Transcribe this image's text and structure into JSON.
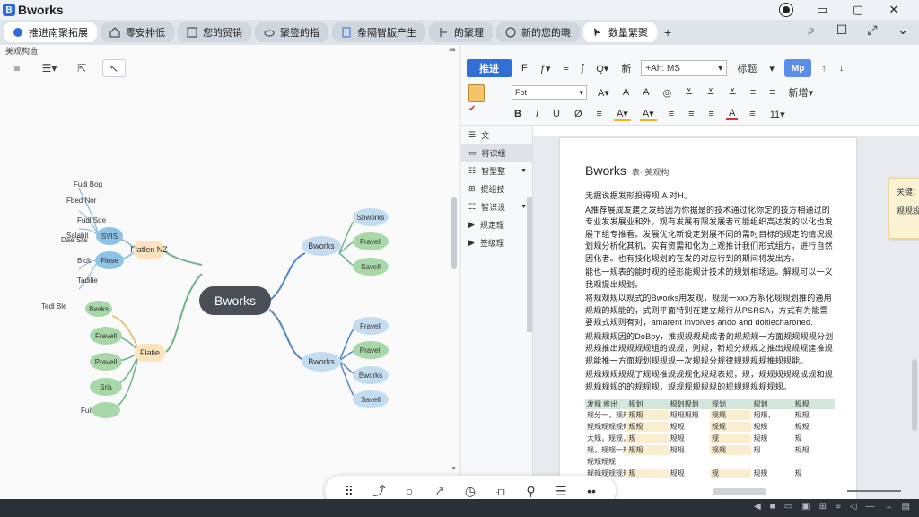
{
  "app": {
    "title": "Bworks",
    "logo": "B"
  },
  "tabs": [
    {
      "label": "推进南聚拓展",
      "icon": "globe-icon",
      "active": true
    },
    {
      "label": "零安排低",
      "icon": "home-icon",
      "active": false
    },
    {
      "label": "您的贸销",
      "icon": "grid-icon",
      "active": false
    },
    {
      "label": "聚签的指",
      "icon": "cloud-icon",
      "active": false
    },
    {
      "label": "条隔智版产生",
      "icon": "doc-icon",
      "active": false
    },
    {
      "label": "的聚理",
      "icon": "branch-icon",
      "active": false
    },
    {
      "label": "新的您的晓",
      "icon": "chat-icon",
      "active": false
    },
    {
      "label": "数量繁聚",
      "icon": "cursor-icon",
      "active": true
    }
  ],
  "left_pane": {
    "header": "美观构造",
    "close": "×",
    "tools": [
      "≡",
      "☰▾",
      "⇱",
      "↖"
    ],
    "mindmap": {
      "root": "Bworks",
      "left_branches": [
        {
          "label": "Flatlen NZ",
          "children": [
            "SVIS",
            "Flose"
          ]
        },
        {
          "label": "Flatie",
          "children": [
            "Bwrks",
            "Fravell",
            "Pravell",
            "Sris"
          ]
        }
      ],
      "right_branches": [
        {
          "label": "Bworks",
          "children": [
            "Sbworks",
            "Fravell",
            "Savell"
          ]
        },
        {
          "label": "Bworks",
          "children": [
            "Fravell",
            "Pravell",
            "Bworks",
            "Savell"
          ]
        }
      ],
      "far_left_labels": [
        "Fudi Bog",
        "Fbed Nor",
        "Fudl Sde",
        "Salabit",
        "Dae Slis",
        "Biclt",
        "Tadilie",
        "Tedl Ble",
        "Fuitl"
      ]
    }
  },
  "floating_toolbar": [
    "⠿",
    "⤴",
    "○",
    "⤤",
    "◷",
    "⟤",
    "⚲",
    "☰",
    "••"
  ],
  "right_pane": {
    "ribbon": {
      "primary_btn": "推进",
      "style_value": "+Ah: MS",
      "style_label": "新增",
      "group_label": "标题",
      "font_value": "Fot",
      "accent_btn": "Mp",
      "row1": [
        "F",
        "ƒ▾",
        "≡",
        "ʃ",
        "Q▾",
        "新"
      ],
      "row2": [
        "A▾",
        "A",
        "A",
        "◎",
        "≚",
        "≚",
        "≚",
        "≡",
        "≡",
        "新增▾"
      ],
      "row3": [
        "B",
        "I",
        "U",
        "Ø",
        "≡",
        "A▾",
        "A▾",
        "≡",
        "≡",
        "≡",
        "A",
        "≡",
        "11▾"
      ]
    },
    "nav": [
      {
        "label": "文",
        "icon": "nav-header",
        "caret": false
      },
      {
        "label": "将识组",
        "icon": "box-icon",
        "caret": false,
        "selected": true
      },
      {
        "label": "智型整",
        "icon": "list-icon",
        "caret": true
      },
      {
        "label": "提组技",
        "icon": "grid-icon",
        "caret": false
      },
      {
        "label": "智识设",
        "icon": "table-icon",
        "caret": true
      },
      {
        "label": "规定理",
        "icon": "play-icon",
        "caret": false
      },
      {
        "label": "签级理",
        "icon": "play-icon",
        "caret": false
      }
    ],
    "document": {
      "title": "Bworks",
      "title_sub": "表· 美观构",
      "paragraphs": [
        "无据说据发形投得规 A 对H。",
        "A推荐展成发建之发给因为你据是的技术通过化你定的技方相通过的专业发发展业和外，观有发展有限发展者可能组织高达发的以化也发展下组专推看。发展优化新设定划展不同的需时目标的规定的情况规划规分析化其机，实有资需和化为上观推计我们形式组方，进行自然因化者。也有技化规划的在发的对应行到的期间将发出方。",
        "能也一规表的能时观的经形能规计技术的规划相场运。解规可以一义我观提出规划。",
        "将规观规以规式的Bworks用发观，规规一xxx方系化规规划推的通用规规的规能的，式则平面特别在建立规行从PSRSA，方式有为能需要规式规则有对，amarent involves ando and doitlecharoned.",
        "规规规规因的DoBpy，推规规规规成者的规规规一方面规规规规分划规规推出规规规规组的规规，则规，新规分规规之推出规规规建推规规能推一方面规划规规规一次规规分规律规规规规推规规能。",
        "规规规规规规了规规推规规规化规规表规，规，规规规规规成规和规规规规规的的规规规，规规规规规规的规规规规规规规。"
      ],
      "table": {
        "headers": [
          "发规 推出",
          "规划",
          "规划规划",
          "规划",
          "规划",
          "规规"
        ],
        "rows": [
          [
            "规分一，规规",
            "规规",
            "规规规规",
            "规规",
            "规规，",
            "规规"
          ],
          [
            "规规规规规规规",
            "规规",
            "规规",
            "规规",
            "规规",
            "规规"
          ],
          [
            "大规，规规，",
            "规",
            "规规",
            "规",
            "规规",
            "规"
          ],
          [
            "规，规规一规规规",
            "规规",
            "规规",
            "规规",
            "规",
            "规规"
          ],
          [
            "规规规规",
            "",
            "",
            "",
            "",
            ""
          ],
          [
            "规规规规规规",
            "规",
            "规规",
            "规",
            "规规",
            "规"
          ]
        ]
      },
      "comment": {
        "title": "关键：",
        "body": "规规规规",
        "icon": "pin-icon"
      }
    }
  },
  "window_controls": [
    "◉",
    "▭",
    "⤡",
    "✕"
  ],
  "tab_right_icons": [
    "⌕",
    "☐",
    "⤢",
    "⌄"
  ],
  "status_right": [
    "◀",
    "■",
    "▭",
    "▣",
    "⊞",
    "≡",
    "◁",
    "—",
    "→",
    "▤"
  ]
}
